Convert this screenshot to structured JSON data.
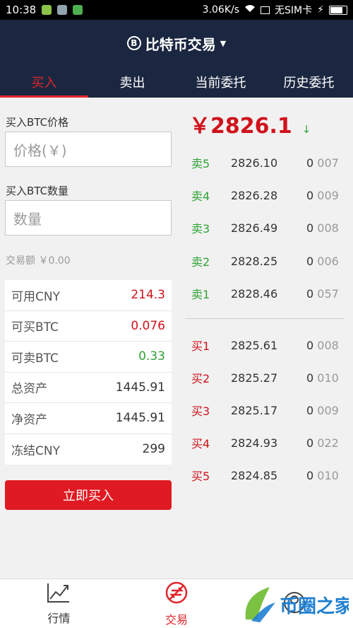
{
  "status_bar": {
    "time": "10:38",
    "speed": "3.06K/s",
    "sim": "无SIM卡"
  },
  "header": {
    "title": "比特币交易",
    "logo_glyph": "B"
  },
  "tabs": [
    {
      "label": "买入",
      "active": true
    },
    {
      "label": "卖出",
      "active": false
    },
    {
      "label": "当前委托",
      "active": false
    },
    {
      "label": "历史委托",
      "active": false
    }
  ],
  "form": {
    "price_label": "买入BTC价格",
    "price_placeholder": "价格(￥)",
    "qty_label": "买入BTC数量",
    "qty_placeholder": "数量",
    "amount_text": "交易额 ￥0.00"
  },
  "stats": [
    {
      "label": "可用CNY",
      "value": "214.3",
      "color": "#d0121b"
    },
    {
      "label": "可买BTC",
      "value": "0.076",
      "color": "#d0121b"
    },
    {
      "label": "可卖BTC",
      "value": "0.33",
      "color": "#2fa336"
    },
    {
      "label": "总资产",
      "value": "1445.91",
      "color": "#333333"
    },
    {
      "label": "净资产",
      "value": "1445.91",
      "color": "#333333"
    },
    {
      "label": "冻结CNY",
      "value": "299",
      "color": "#333333"
    }
  ],
  "buy_button": "立即买入",
  "ticker": {
    "price": "￥2826.1",
    "direction_icon": "↓"
  },
  "asks": [
    {
      "label": "卖5",
      "price": "2826.10",
      "qty_main": "0",
      "qty_dim": "007"
    },
    {
      "label": "卖4",
      "price": "2826.28",
      "qty_main": "0",
      "qty_dim": "009"
    },
    {
      "label": "卖3",
      "price": "2826.49",
      "qty_main": "0",
      "qty_dim": "008"
    },
    {
      "label": "卖2",
      "price": "2828.25",
      "qty_main": "0",
      "qty_dim": "006"
    },
    {
      "label": "卖1",
      "price": "2828.46",
      "qty_main": "0",
      "qty_dim": "057"
    }
  ],
  "bids": [
    {
      "label": "买1",
      "price": "2825.61",
      "qty_main": "0",
      "qty_dim": "008"
    },
    {
      "label": "买2",
      "price": "2825.27",
      "qty_main": "0",
      "qty_dim": "010"
    },
    {
      "label": "买3",
      "price": "2825.17",
      "qty_main": "0",
      "qty_dim": "009"
    },
    {
      "label": "买4",
      "price": "2824.93",
      "qty_main": "0",
      "qty_dim": "022"
    },
    {
      "label": "买5",
      "price": "2824.85",
      "qty_main": "0",
      "qty_dim": "010"
    }
  ],
  "colors": {
    "ask": "#2fa336",
    "bid": "#d0121b",
    "accent": "#e0262b",
    "header_bg": "#1b2740"
  },
  "bottom_nav": [
    {
      "label": "行情",
      "icon": "chart-icon",
      "active": false
    },
    {
      "label": "交易",
      "icon": "trade-icon",
      "active": true
    },
    {
      "label": "",
      "icon": "account-icon",
      "active": false
    }
  ],
  "watermark": {
    "text": "币圈之家"
  }
}
